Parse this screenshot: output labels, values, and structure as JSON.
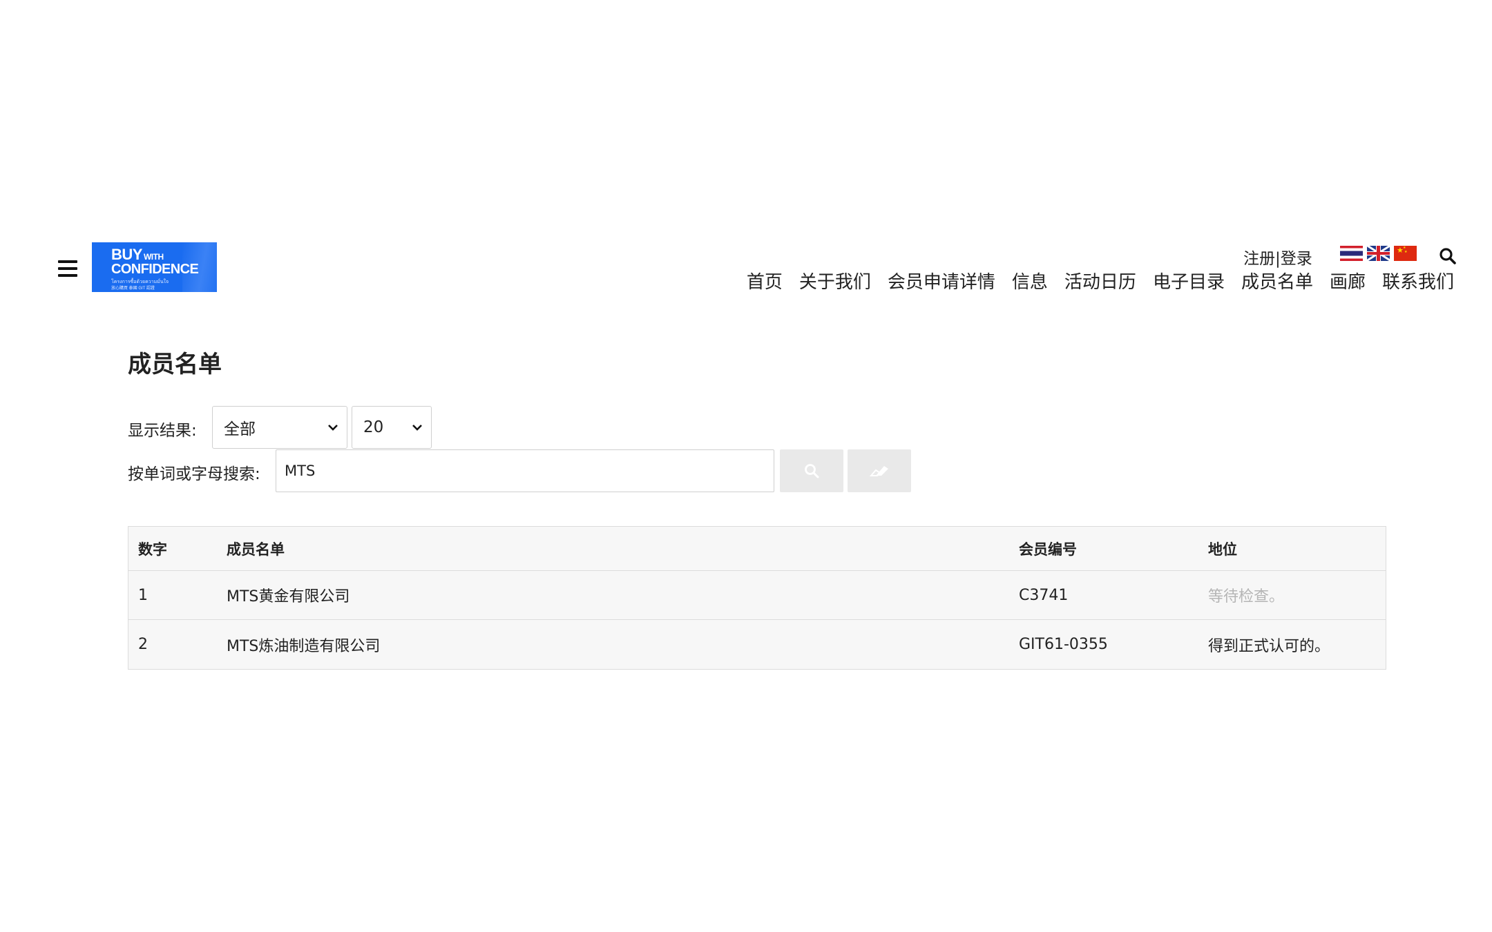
{
  "header": {
    "logo": {
      "line1": "BUY",
      "line1_small": "WITH",
      "line2": "CONFIDENCE",
      "line3": "โครงการซื้อด้วยความมั่นใจ",
      "line4": "放心購買 泰國 GIT 認證"
    },
    "account": {
      "register": "注册",
      "separator": "|",
      "login": "登录"
    },
    "languages": [
      "th-flag-icon",
      "uk-flag-icon",
      "cn-flag-icon"
    ],
    "nav": [
      "首页",
      "关于我们",
      "会员申请详情",
      "信息",
      "活动日历",
      "电子目录",
      "成员名单",
      "画廊",
      "联系我们"
    ]
  },
  "main": {
    "title": "成员名单",
    "filter": {
      "label": "显示结果:",
      "status_value": "全部",
      "page_size_value": "20"
    },
    "search": {
      "label": "按单词或字母搜索:",
      "value": "MTS"
    },
    "table": {
      "columns": [
        "数字",
        "成员名单",
        "会员编号",
        "地位"
      ],
      "rows": [
        {
          "num": "1",
          "name": "MTS黄金有限公司",
          "code": "C3741",
          "status": "等待检查。"
        },
        {
          "num": "2",
          "name": "MTS炼油制造有限公司",
          "code": "GIT61-0355",
          "status": "得到正式认可的。"
        }
      ]
    }
  },
  "colors": {
    "logo_blue": "#1a6cf0",
    "table_bg": "#f7f7f7",
    "pending_text": "#b5b5b5",
    "button_bg": "#e9e9e9"
  }
}
